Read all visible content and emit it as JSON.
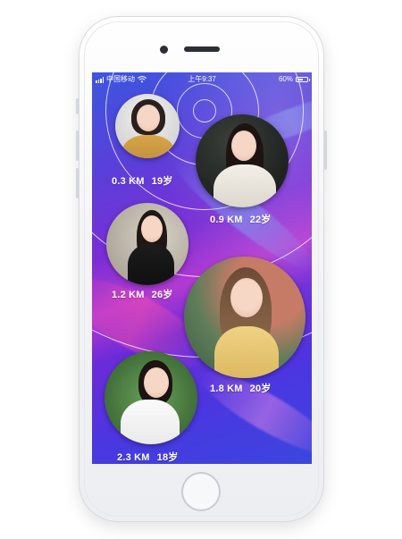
{
  "status_bar": {
    "carrier": "中国移动",
    "time": "上午9:37",
    "battery_text": "60%",
    "battery_level": 0.6
  },
  "profiles": [
    {
      "id": 1,
      "distance": "0.3 KM",
      "age": "19岁"
    },
    {
      "id": 2,
      "distance": "0.9 KM",
      "age": "22岁"
    },
    {
      "id": 3,
      "distance": "1.2 KM",
      "age": "26岁"
    },
    {
      "id": 4,
      "distance": "1.8 KM",
      "age": "20岁"
    },
    {
      "id": 5,
      "distance": "2.3 KM",
      "age": "18岁"
    }
  ],
  "colors": {
    "screen_gradient_start": "#3c56e0",
    "screen_gradient_mid": "#7a2ed6",
    "screen_gradient_end": "#3b46de",
    "text": "#ffffff",
    "radar_ring": "#ffffff"
  }
}
